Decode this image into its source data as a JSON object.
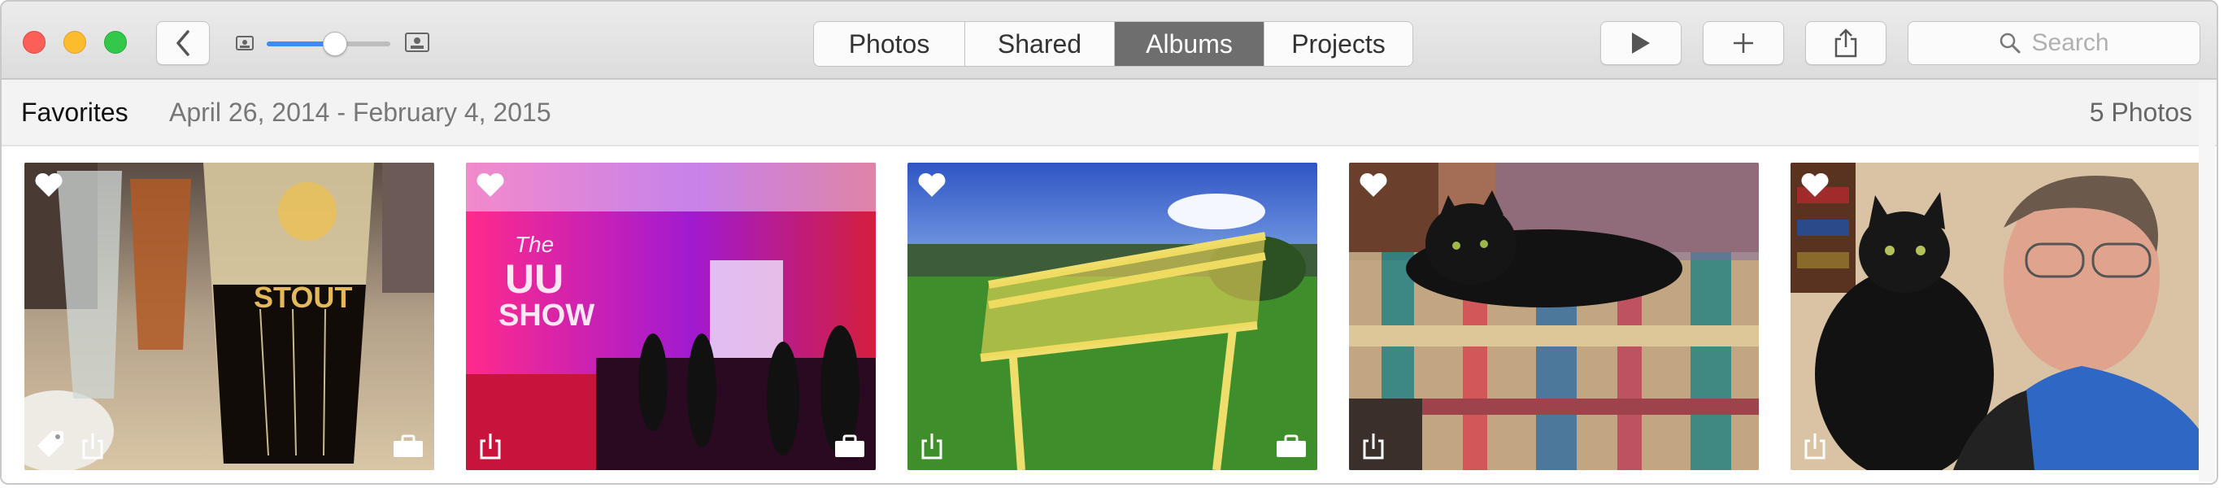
{
  "toolbar": {
    "tabs": [
      {
        "label": "Photos",
        "active": false
      },
      {
        "label": "Shared",
        "active": false
      },
      {
        "label": "Albums",
        "active": true
      },
      {
        "label": "Projects",
        "active": false
      }
    ],
    "search_placeholder": "Search",
    "zoom_level": 0.55,
    "icons": {
      "back": "chevron-left-icon",
      "play": "play-icon",
      "add": "plus-icon",
      "share": "share-icon",
      "search": "search-icon",
      "zoom_small": "small-photo-icon",
      "zoom_large": "large-photo-icon"
    }
  },
  "album": {
    "title": "Favorites",
    "date_range": "April 26, 2014 - February 4, 2015",
    "count": "5 Photos"
  },
  "photos": [
    {
      "subject": "beer-glasses",
      "favorite": true,
      "tag_icon": true,
      "shared_icon": true,
      "toolbox_icon": true
    },
    {
      "subject": "stage-show",
      "favorite": true,
      "tag_icon": false,
      "shared_icon": true,
      "toolbox_icon": true
    },
    {
      "subject": "yellow-bench",
      "favorite": true,
      "tag_icon": false,
      "shared_icon": true,
      "toolbox_icon": true
    },
    {
      "subject": "black-cat-sofa",
      "favorite": true,
      "tag_icon": false,
      "shared_icon": true,
      "toolbox_icon": false
    },
    {
      "subject": "cat-and-man",
      "favorite": true,
      "tag_icon": false,
      "shared_icon": true,
      "toolbox_icon": false
    }
  ],
  "colors": {
    "accent": "#3b8cf6",
    "active_tab": "#6e6e6e",
    "close": "#fc5f57",
    "minimize": "#fdbc2e",
    "maximize": "#34c84a"
  }
}
